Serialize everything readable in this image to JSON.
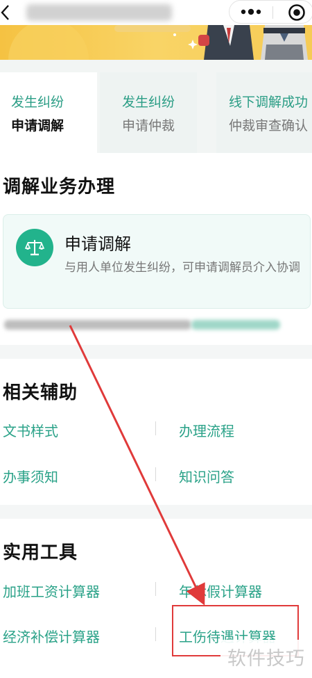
{
  "colors": {
    "accent": "#2aa288",
    "banner": "#f5c242",
    "annotation": "#e03a3a",
    "tab_bg": "#eef3f2"
  },
  "nav": {
    "back_icon": "chevron-left-icon",
    "title": "",
    "more_icon": "more-dots-icon",
    "close_icon": "target-icon"
  },
  "tabs": [
    {
      "line1": "发生纠纷",
      "line2": "申请调解",
      "active": true
    },
    {
      "line1": "发生纠纷",
      "line2": "申请仲裁",
      "active": false
    },
    {
      "line1": "线下调解成功",
      "line2": "仲裁审查确认",
      "active": false
    }
  ],
  "mediation": {
    "title": "调解业务办理",
    "card": {
      "icon": "scales-icon",
      "title": "申请调解",
      "desc": "与用人单位发生纠纷，可申请调解员介入协调"
    }
  },
  "assist": {
    "title": "相关辅助",
    "links": [
      "文书样式",
      "办理流程",
      "办事须知",
      "知识问答"
    ]
  },
  "tools": {
    "title": "实用工具",
    "links": [
      "加班工资计算器",
      "年休假计算器",
      "经济补偿计算器",
      "工伤待遇计算器"
    ]
  },
  "watermark": "软件技巧"
}
